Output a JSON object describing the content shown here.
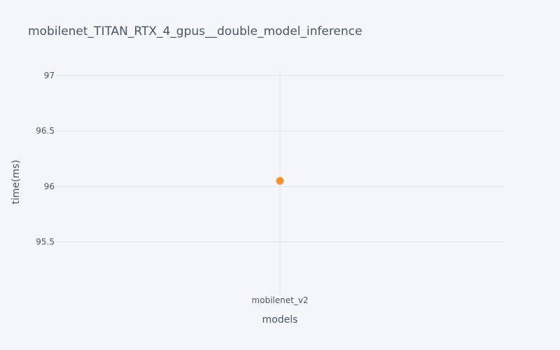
{
  "chart_data": {
    "type": "scatter",
    "title": "mobilenet_TITAN_RTX_4_gpus__double_model_inference",
    "xlabel": "models",
    "ylabel": "time(ms)",
    "categories": [
      "mobilenet_v2"
    ],
    "series": [
      {
        "values": [
          96.05
        ],
        "color": "#f7922f"
      }
    ],
    "yticks": [
      95.5,
      96,
      96.5,
      97
    ],
    "ytick_labels": [
      "95.5",
      "96",
      "96.5",
      "97"
    ],
    "ylim": [
      95.03,
      97.05
    ],
    "grid": true,
    "background_color": "#f5f6fa",
    "grid_color": "#e4e6ee"
  }
}
